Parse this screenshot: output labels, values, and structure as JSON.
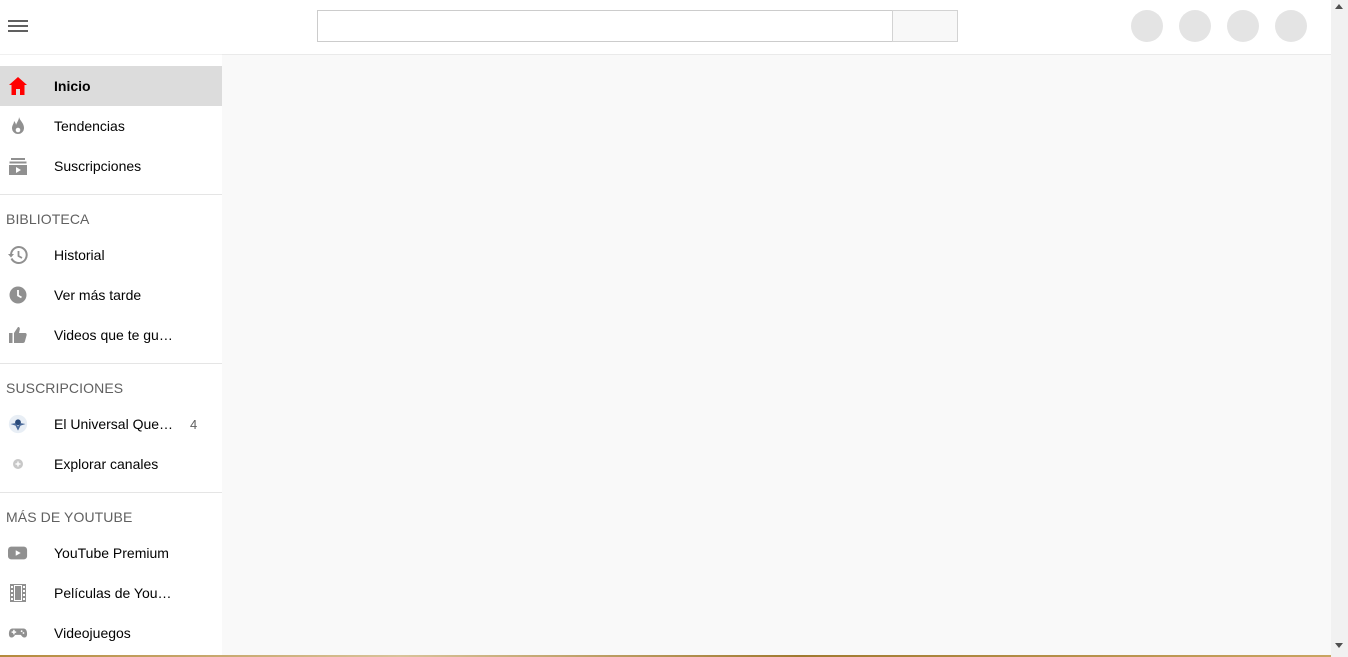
{
  "search": {
    "placeholder": ""
  },
  "sidebar": {
    "main": [
      {
        "label": "Inicio",
        "icon": "home-icon",
        "active": true
      },
      {
        "label": "Tendencias",
        "icon": "flame-icon"
      },
      {
        "label": "Suscripciones",
        "icon": "subscriptions-icon"
      }
    ],
    "library_title": "BIBLIOTECA",
    "library": [
      {
        "label": "Historial",
        "icon": "history-icon"
      },
      {
        "label": "Ver más tarde",
        "icon": "clock-icon"
      },
      {
        "label": "Videos que te gu…",
        "icon": "thumbs-up-icon"
      }
    ],
    "subs_title": "SUSCRIPCIONES",
    "subs": [
      {
        "label": "El Universal Que…",
        "icon": "channel-avatar",
        "count": "4"
      },
      {
        "label": "Explorar canales",
        "icon": "add-circle-icon"
      }
    ],
    "more_title": "MÁS DE YOUTUBE",
    "more": [
      {
        "label": "YouTube Premium",
        "icon": "youtube-icon"
      },
      {
        "label": "Películas de YouT…",
        "icon": "film-icon"
      },
      {
        "label": "Videojuegos",
        "icon": "gamepad-icon"
      }
    ]
  },
  "colors": {
    "accent": "#ff0000",
    "icon": "#909090",
    "active_bg": "#dcdcdc"
  }
}
